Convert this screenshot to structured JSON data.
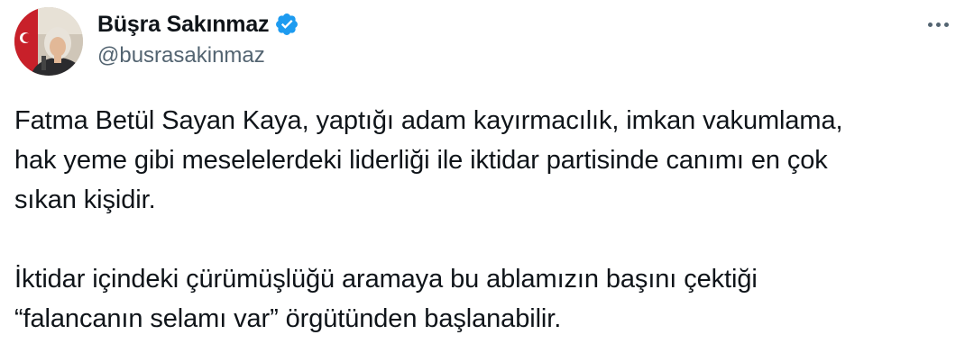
{
  "author": {
    "display_name": "Büşra Sakınmaz",
    "handle": "@busrasakinmaz",
    "verified": true,
    "avatar_icon": "profile-photo"
  },
  "header": {
    "more_icon": "ellipsis-horizontal-icon"
  },
  "tweet": {
    "paragraph_1": "Fatma Betül Sayan Kaya, yaptığı adam kayırmacılık, imkan vakumlama,\nhak yeme gibi meselelerdeki liderliği ile iktidar partisinde canımı en çok\nsıkan kişidir.",
    "paragraph_2": "İktidar içindeki çürümüşlüğü aramaya bu ablamızın başını çektiği\n“falancanın selamı var” örgütünden başlanabilir."
  },
  "colors": {
    "text_primary": "#0f1419",
    "text_secondary": "#536471",
    "verified_blue": "#1d9bf0"
  }
}
